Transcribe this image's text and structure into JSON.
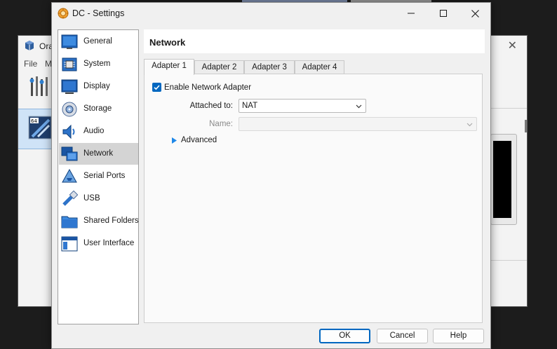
{
  "background_window": {
    "title": "Ora",
    "menu": [
      "File",
      "M"
    ]
  },
  "dialog": {
    "title": "DC - Settings"
  },
  "sidebar": {
    "items": [
      {
        "label": "General",
        "icon": "general-icon"
      },
      {
        "label": "System",
        "icon": "system-icon"
      },
      {
        "label": "Display",
        "icon": "display-icon"
      },
      {
        "label": "Storage",
        "icon": "storage-icon"
      },
      {
        "label": "Audio",
        "icon": "audio-icon"
      },
      {
        "label": "Network",
        "icon": "network-icon",
        "selected": true
      },
      {
        "label": "Serial Ports",
        "icon": "serial-ports-icon"
      },
      {
        "label": "USB",
        "icon": "usb-icon"
      },
      {
        "label": "Shared Folders",
        "icon": "shared-folders-icon"
      },
      {
        "label": "User Interface",
        "icon": "user-interface-icon"
      }
    ]
  },
  "page": {
    "title": "Network"
  },
  "tabs": [
    {
      "label": "Adapter 1",
      "active": true
    },
    {
      "label": "Adapter 2"
    },
    {
      "label": "Adapter 3"
    },
    {
      "label": "Adapter 4"
    }
  ],
  "adapter": {
    "enable_label": "Enable Network Adapter",
    "enabled": true,
    "attached_label": "Attached to:",
    "attached_value": "NAT",
    "name_label": "Name:",
    "name_value": "",
    "advanced_label": "Advanced"
  },
  "buttons": {
    "ok": "OK",
    "cancel": "Cancel",
    "help": "Help"
  },
  "colors": {
    "accent": "#0067c0",
    "selection": "#d4d4d4"
  }
}
